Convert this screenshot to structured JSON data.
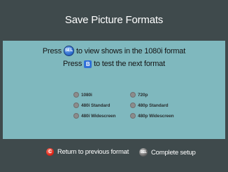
{
  "header": {
    "title": "Save Picture Formats"
  },
  "instructions": {
    "line1": {
      "pre": "Press",
      "button": "SEL",
      "post": "to view shows in the 1080i format"
    },
    "line2": {
      "pre": "Press",
      "button": "B",
      "post": "to test the next format"
    }
  },
  "formats": {
    "left": [
      "1080i",
      "480i Standard",
      "480i Widescreen"
    ],
    "right": [
      "720p",
      "480p Standard",
      "480p Widescreen"
    ]
  },
  "footer": {
    "return": {
      "button": "C",
      "label": "Return to previous format"
    },
    "complete": {
      "button": "SEL",
      "label": "Complete setup"
    }
  },
  "colors": {
    "frame": "#3f4a4c",
    "panel": "#7fb8be",
    "sel_button": "#2f6fd0",
    "b_button": "#2f6fd8",
    "c_button": "#e0281a"
  }
}
